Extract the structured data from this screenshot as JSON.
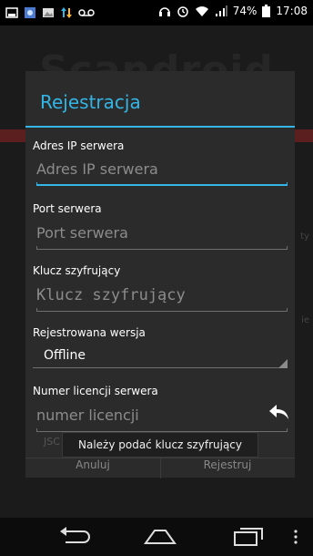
{
  "status_bar": {
    "battery_percent": "74%",
    "time": "17:08",
    "icons": [
      "screenshot-icon",
      "gallery-icon",
      "image-icon",
      "data-transfer-icon",
      "voicemail-icon",
      "headphones-icon",
      "alarm-icon",
      "wifi-icon",
      "signal-icon",
      "battery-icon"
    ]
  },
  "app": {
    "title": "Scandroid",
    "side_text_1": "ty",
    "side_text_2": "ie"
  },
  "dialog": {
    "title": "Rejestracja",
    "fields": [
      {
        "label": "Adres IP serwera",
        "value": "",
        "placeholder": "Adres IP serwera"
      },
      {
        "label": "Port serwera",
        "value": "",
        "placeholder": "Port serwera"
      },
      {
        "label": "Klucz szyfrujący",
        "value": "",
        "placeholder": "Klucz szyfrujący"
      }
    ],
    "version": {
      "label": "Rejestrowana wersja",
      "selected": "Offline"
    },
    "license": {
      "label": "Numer licencji serwera",
      "value": "",
      "placeholder": "numer licencji"
    },
    "hint_below": "JSC",
    "cancel_label": "Anuluj",
    "register_label": "Rejestruj"
  },
  "toast": {
    "message": "Należy podać klucz szyfrujący"
  },
  "colors": {
    "accent": "#33b5e5",
    "dialog_bg": "#2b2b2b"
  }
}
